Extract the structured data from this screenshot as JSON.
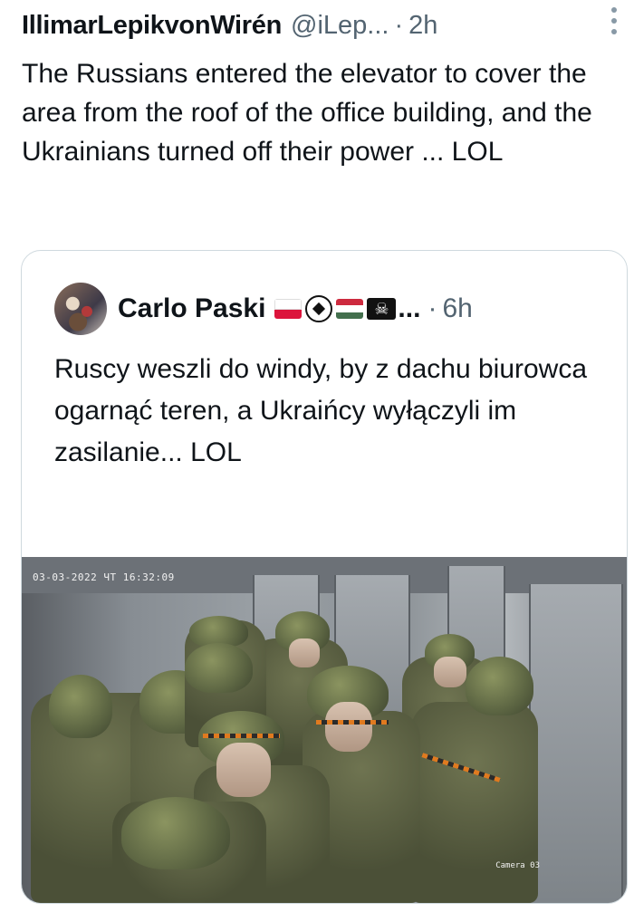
{
  "tweet": {
    "author_name": "IllimarLepikvonWirén",
    "handle": "@iLep...",
    "separator": "·",
    "time": "2h",
    "text": "The Russians entered the elevator to cover the area from the roof of the office building, and the Ukrainians turned off their power ... LOL"
  },
  "quoted_tweet": {
    "author_name": "Carlo Paski",
    "flag_icons": [
      "poland-flag-icon",
      "soccer-ball-icon",
      "hungary-flag-icon",
      "pirate-flag-icon"
    ],
    "ellipsis": "...",
    "separator": "·",
    "time": "6h",
    "text": "Ruscy weszli do windy, by z dachu biurowca ogarnąć teren, a Ukraińcy wyłączyli im zasilanie... LOL",
    "image": {
      "timestamp_overlay": "03-03-2022 ЧТ 16:32:09",
      "camera_overlay": "Camera 03"
    }
  },
  "colors": {
    "text": "#0f1419",
    "secondary": "#536471",
    "border": "#cfd9de"
  }
}
